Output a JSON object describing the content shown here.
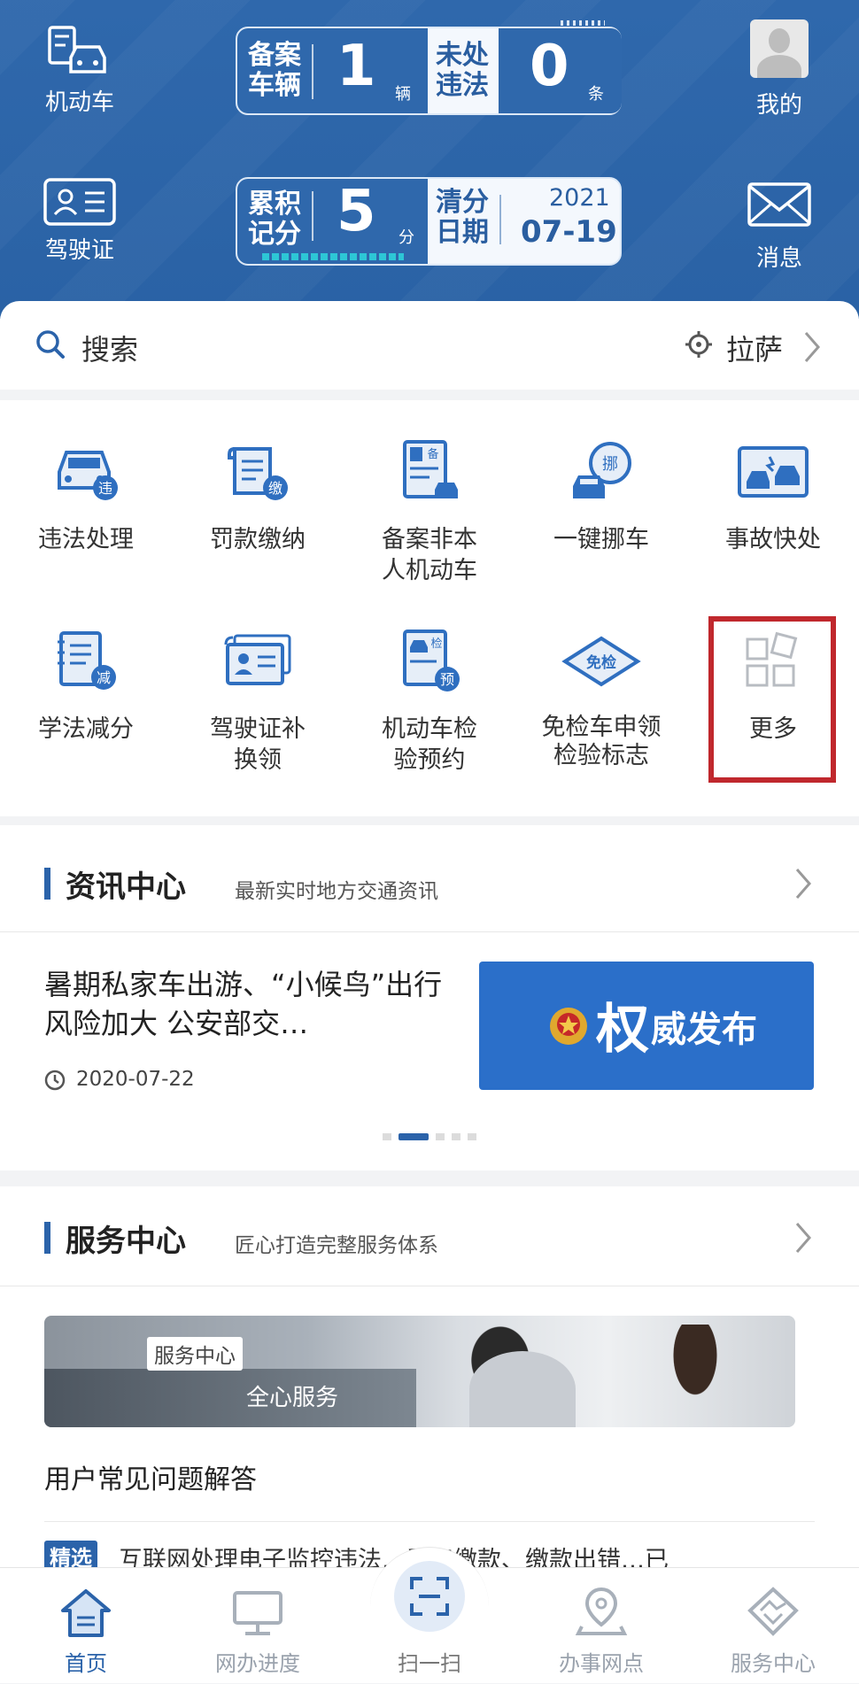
{
  "header": {
    "vehicle_label": "机动车",
    "license_label": "驾驶证",
    "mine_label": "我的",
    "message_label": "消息",
    "vehicles": {
      "label_line1": "备案",
      "label_line2": "车辆",
      "count": "1",
      "unit": "辆"
    },
    "violations": {
      "label_line1": "未处",
      "label_line2": "违法",
      "count": "0",
      "unit": "条"
    },
    "points": {
      "label_line1": "累积",
      "label_line2": "记分",
      "count": "5",
      "unit": "分"
    },
    "clear_date": {
      "label_line1": "清分",
      "label_line2": "日期",
      "year": "2021",
      "date": "07-19"
    }
  },
  "search": {
    "label": "搜索",
    "city": "拉萨"
  },
  "services": [
    {
      "label": "违法处理",
      "badge": "违"
    },
    {
      "label": "罚款缴纳",
      "badge": "缴"
    },
    {
      "label": "备案非本\n人机动车",
      "badge": "备"
    },
    {
      "label": "一键挪车",
      "badge": "挪"
    },
    {
      "label": "事故快处",
      "badge": ""
    },
    {
      "label": "学法减分",
      "badge": "减"
    },
    {
      "label": "驾驶证补\n换领",
      "badge": ""
    },
    {
      "label": "机动车检\n验预约",
      "badge": "检",
      "badge2": "预"
    },
    {
      "label": "免检车申领\n检验标志",
      "badge": "免检"
    },
    {
      "label": "更多",
      "badge": ""
    }
  ],
  "news": {
    "title": "资讯中心",
    "subtitle": "最新实时地方交通资讯",
    "article_title": "暑期私家车出游、“小候鸟”出行风险加大 公安部交…",
    "article_date": "2020-07-22",
    "banner_text_big": "权",
    "banner_text": "威发布"
  },
  "service_center": {
    "title": "服务中心",
    "subtitle": "匠心打造完整服务体系",
    "banner_tag": "服务中心",
    "banner_text": "全心服务",
    "faq_title": "用户常见问题解答",
    "faq_tag": "精选",
    "faq_item": "互联网处理电子监控违法…重复缴款、缴款出错…已"
  },
  "tabs": [
    {
      "label": "首页",
      "active": true
    },
    {
      "label": "网办进度",
      "active": false
    },
    {
      "label": "扫一扫",
      "active": false
    },
    {
      "label": "办事网点",
      "active": false
    },
    {
      "label": "服务中心",
      "active": false
    }
  ],
  "colors": {
    "brand": "#2b63aa",
    "highlight_box": "#c0282d",
    "icon_blue": "#2f6fc0"
  }
}
